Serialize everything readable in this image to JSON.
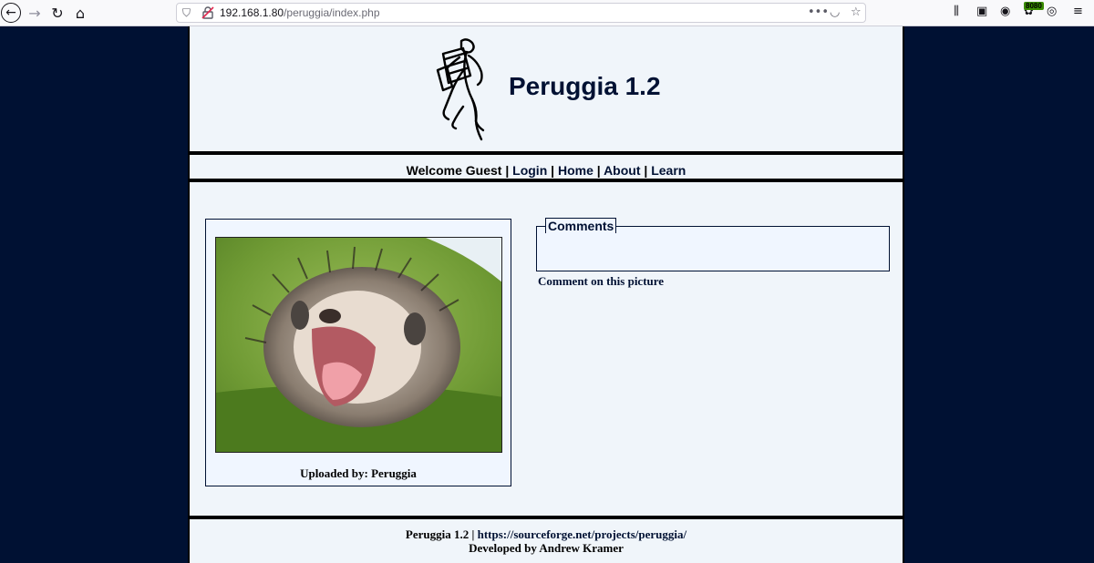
{
  "browser": {
    "url_host": "192.168.1.80",
    "url_path": "/peruggia/index.php",
    "badge": "8080"
  },
  "site": {
    "title": "Peruggia 1.2"
  },
  "nav": {
    "welcome": "Welcome Guest",
    "sep": "|",
    "login": "Login",
    "home": "Home",
    "about": "About",
    "learn": "Learn"
  },
  "picture": {
    "uploaded_by": "Uploaded by: Peruggia"
  },
  "comments": {
    "legend": "Comments",
    "comment_link": "Comment on this picture"
  },
  "footer": {
    "name": "Peruggia 1.2",
    "sep": "|",
    "link": "https://sourceforge.net/projects/peruggia/",
    "developer": "Developed by Andrew Kramer"
  },
  "colors": {
    "background": "#001133",
    "page": "#f0f5fa",
    "text": "#001133"
  }
}
